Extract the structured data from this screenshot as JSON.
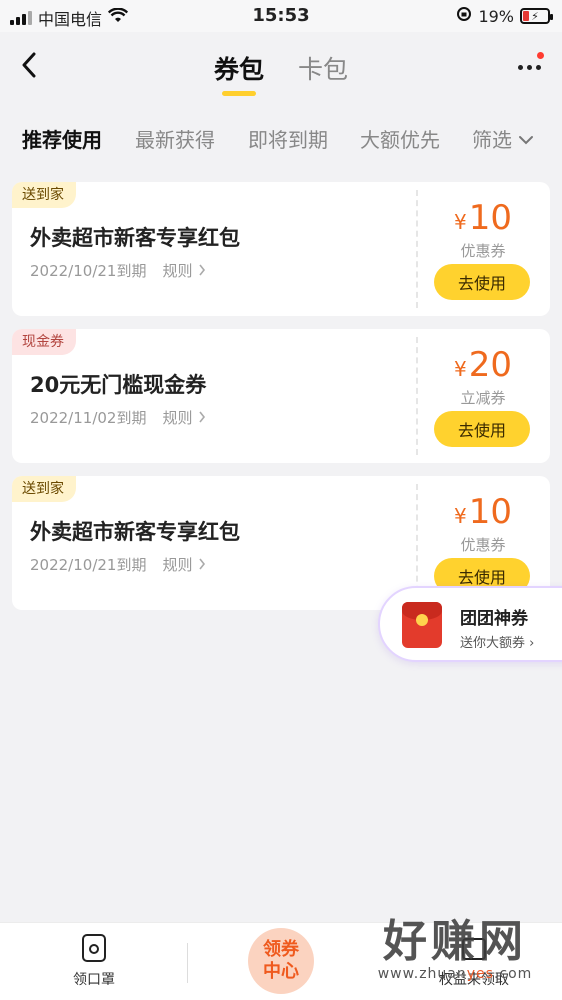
{
  "status_bar": {
    "carrier": "中国电信",
    "time": "15:53",
    "battery": "19%"
  },
  "header": {
    "tabs": [
      {
        "label": "券包",
        "active": true
      },
      {
        "label": "卡包",
        "active": false
      }
    ],
    "back_icon": "chevron-left-icon",
    "more_icon": "more-dots-icon"
  },
  "filters": [
    {
      "label": "推荐使用",
      "active": true
    },
    {
      "label": "最新获得",
      "active": false
    },
    {
      "label": "即将到期",
      "active": false
    },
    {
      "label": "大额优先",
      "active": false
    },
    {
      "label": "筛选",
      "active": false
    }
  ],
  "coupons": [
    {
      "tag": "送到家",
      "tag_color": "#fff3cc",
      "title": "外卖超市新客专享红包",
      "expiry": "2022/10/21到期",
      "rule": "规则",
      "currency": "¥",
      "amount": "10",
      "type": "优惠券",
      "button": "去使用"
    },
    {
      "tag": "现金券",
      "tag_color": "#fde3e3",
      "title": "20元无门槛现金券",
      "expiry": "2022/11/02到期",
      "rule": "规则",
      "currency": "¥",
      "amount": "20",
      "type": "立减券",
      "button": "去使用"
    },
    {
      "tag": "送到家",
      "tag_color": "#fff3cc",
      "title": "外卖超市新客专享红包",
      "expiry": "2022/10/21到期",
      "rule": "规则",
      "currency": "¥",
      "amount": "10",
      "type": "优惠券",
      "button": "去使用"
    }
  ],
  "promo": {
    "title": "团团神券",
    "subtitle": "送你大额券 ›"
  },
  "bottom_bar": {
    "left_label": "领口罩",
    "center_line1": "领券",
    "center_line2": "中心",
    "right_label": "权益来领取"
  },
  "watermark": {
    "big": "好赚网",
    "small_prefix": "www.zhuan",
    "small_highlight": "yes",
    "small_suffix": ".com"
  },
  "colors": {
    "accent_yellow": "#ffd22e",
    "price_orange": "#ef6a1e",
    "background": "#f2f2f4"
  }
}
